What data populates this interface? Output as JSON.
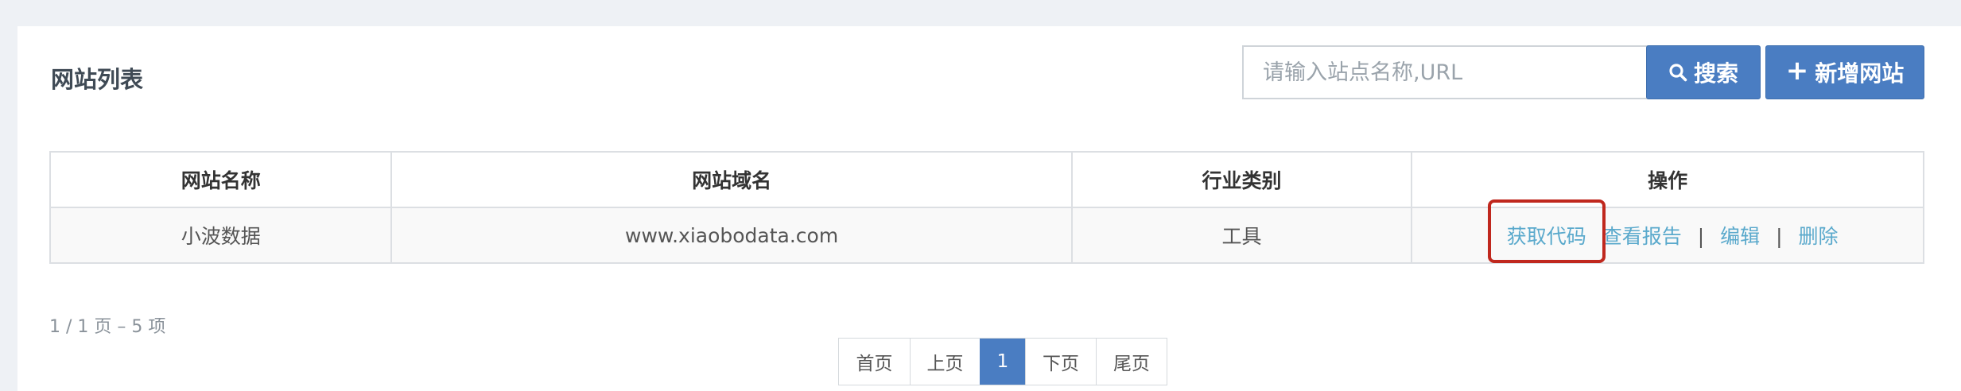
{
  "page": {
    "title": "网站列表"
  },
  "search": {
    "placeholder": "请输入站点名称,URL",
    "value": ""
  },
  "toolbar": {
    "search_label": "搜索",
    "add_label": "新增网站"
  },
  "table": {
    "columns": [
      "网站名称",
      "网站域名",
      "行业类别",
      "操作"
    ],
    "rows": [
      {
        "name": "小波数据",
        "domain": "www.xiaobodata.com",
        "category": "工具",
        "actions": [
          "获取代码",
          "查看报告",
          "编辑",
          "删除"
        ]
      }
    ],
    "action_separator": "|"
  },
  "pagination": {
    "summary": "1 / 1 页 – 5 项",
    "first": "首页",
    "prev": "上页",
    "current": "1",
    "next": "下页",
    "last": "尾页"
  },
  "colors": {
    "primary": "#4a7dc2",
    "link": "#5aa9cc",
    "highlight": "#c0281e",
    "background": "#eef1f5"
  },
  "icons": {
    "search": "search-icon",
    "add": "plus-icon"
  }
}
